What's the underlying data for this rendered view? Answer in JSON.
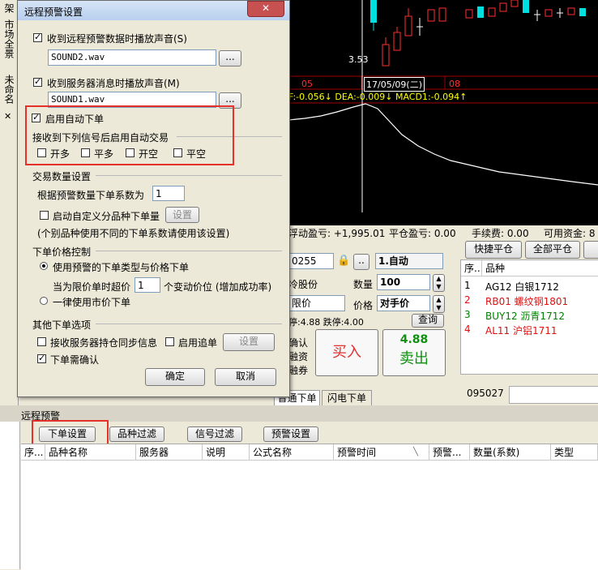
{
  "left_strip": {
    "tab1": "市场全景",
    "tab2": "未命名",
    "close": "✕"
  },
  "chart": {
    "price_label": "3.53",
    "axis_left": "05",
    "date_box": "17/05/09(二)",
    "axis_right": "08",
    "macd_text": "F:-0.056↓ DEA:-0.009↓ MACD1:-0.094↑",
    "colors": {
      "up": "#ff3030",
      "down": "#00ffff",
      "white": "#ffffff",
      "yellow": "#ffff00",
      "magenta": "#ff00ff"
    }
  },
  "account_bar": {
    "float_pnl": "浮动盈亏: +1,995.01",
    "close_pnl": "平仓盈亏: 0.00",
    "fee": "手续费: 0.00",
    "available": "可用资金: 8"
  },
  "order_panel": {
    "code": "0255",
    "contract_select": "1.自动",
    "stock_label": "冷股份",
    "qty_label": "数量",
    "qty_value": "100",
    "price_type": "限价",
    "price_label": "价格",
    "price_value": "对手价",
    "limit_text": "停:4.88 跌停:4.00",
    "query_btn": "查询",
    "side_labels": [
      "确认",
      "融资",
      "融券"
    ],
    "buy_label": "买入",
    "sell_price": "4.88",
    "sell_label": "卖出",
    "tabs": [
      "普通下单",
      "闪电下单"
    ],
    "ellipsis": ".."
  },
  "right_panel": {
    "btn_quick": "快捷平仓",
    "btn_all": "全部平仓",
    "col_seq": "序...",
    "col_name": "品种",
    "rows": [
      {
        "seq": "1",
        "name": "AG12 白银1712",
        "color": "#000000"
      },
      {
        "seq": "2",
        "name": "RB01 螺纹钢1801",
        "color": "#e01010"
      },
      {
        "seq": "3",
        "name": "BUY12 沥青1712",
        "color": "#008000"
      },
      {
        "seq": "4",
        "name": "AL11 沪铝1711",
        "color": "#e01010"
      }
    ],
    "status_code": "095027"
  },
  "bottom": {
    "title": "远程预警",
    "tabs": [
      "下单设置",
      "品种过滤",
      "信号过滤",
      "预警设置"
    ],
    "columns": [
      "序...",
      "品种名称",
      "服务器",
      "说明",
      "公式名称",
      "预警时间",
      "预警...",
      "数量(系数)",
      "类型"
    ]
  },
  "dialog": {
    "title": "远程预警设置",
    "close": "✕",
    "cb_sound_remote": "收到远程预警数据时播放声音(S)",
    "sound_file1": "SOUND2.wav",
    "browse": "...",
    "cb_sound_server": "收到服务器消息时播放声音(M)",
    "sound_file2": "SOUND1.wav",
    "cb_auto": "启用自动下单",
    "auto_group": "接收到下列信号后启用自动交易",
    "sig_open_long": "开多",
    "sig_close_long": "平多",
    "sig_open_short": "开空",
    "sig_close_short": "平空",
    "qty_group": "交易数量设置",
    "qty_coef_label": "根据预警数量下单系数为",
    "qty_coef": "1",
    "cb_custom": "启动自定义分品种下单量",
    "setting_btn": "设置",
    "custom_note": "(个别品种使用不同的下单系数请使用该设置)",
    "price_group": "下单价格控制",
    "rb_use_signal": "使用预警的下单类型与价格下单",
    "limit_exceed_prefix": "当为限价单时超价",
    "limit_exceed_val": "1",
    "limit_exceed_suffix": "个变动价位 (增加成功率)",
    "rb_market": "一律使用市价下单",
    "other_group": "其他下单选项",
    "cb_sync": "接收服务器持仓同步信息",
    "cb_chase": "启用追单",
    "setting_btn2": "设置",
    "cb_confirm": "下单需确认",
    "ok": "确定",
    "cancel": "取消"
  }
}
